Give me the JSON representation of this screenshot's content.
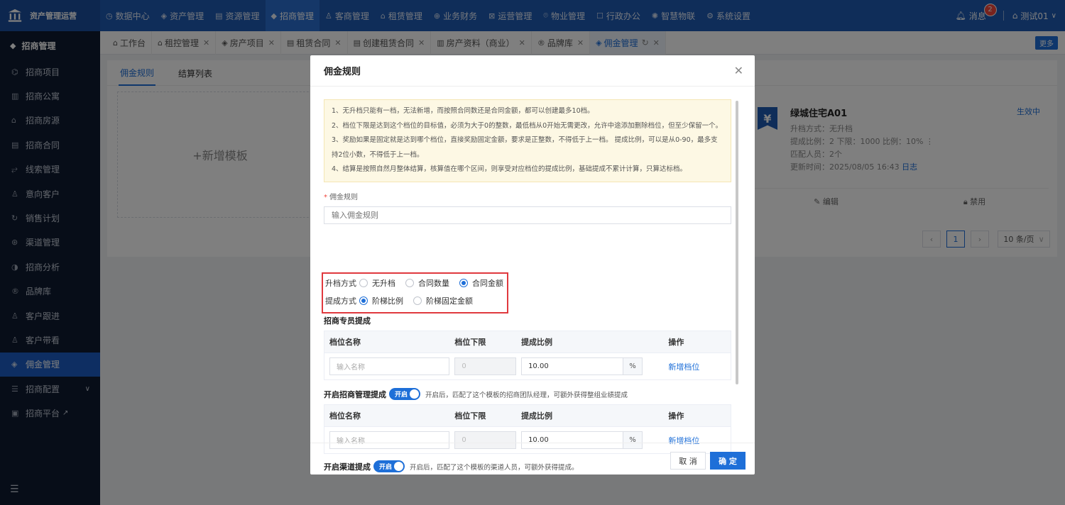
{
  "app": {
    "title": "资产管理运营"
  },
  "topnav": [
    {
      "label": "数据中心",
      "icon": "◷"
    },
    {
      "label": "资产管理",
      "icon": "◈"
    },
    {
      "label": "资源管理",
      "icon": "▤"
    },
    {
      "label": "招商管理",
      "icon": "◆",
      "active": true
    },
    {
      "label": "客商管理",
      "icon": "♙"
    },
    {
      "label": "租赁管理",
      "icon": "⌂"
    },
    {
      "label": "业务财务",
      "icon": "⊕"
    },
    {
      "label": "运营管理",
      "icon": "⊠"
    },
    {
      "label": "物业管理",
      "icon": "⌾"
    },
    {
      "label": "行政办公",
      "icon": "☐"
    },
    {
      "label": "智慧物联",
      "icon": "✺"
    },
    {
      "label": "系统设置",
      "icon": "⚙"
    }
  ],
  "header": {
    "message_label": "消息",
    "message_count": "2",
    "user_name": "测试01"
  },
  "sidebar": {
    "title": "招商管理",
    "items": [
      {
        "label": "招商项目",
        "icon": "⌬"
      },
      {
        "label": "招商公寓",
        "icon": "▥"
      },
      {
        "label": "招商房源",
        "icon": "⌂"
      },
      {
        "label": "招商合同",
        "icon": "▤"
      },
      {
        "label": "线索管理",
        "icon": "⥂"
      },
      {
        "label": "意向客户",
        "icon": "♙"
      },
      {
        "label": "销售计划",
        "icon": "↻"
      },
      {
        "label": "渠道管理",
        "icon": "⊛"
      },
      {
        "label": "招商分析",
        "icon": "◑"
      },
      {
        "label": "品牌库",
        "icon": "®"
      },
      {
        "label": "客户跟进",
        "icon": "♙"
      },
      {
        "label": "客户带看",
        "icon": "♙"
      },
      {
        "label": "佣金管理",
        "icon": "◈",
        "active": true
      },
      {
        "label": "招商配置",
        "icon": "☰"
      },
      {
        "label": "招商平台",
        "icon": "▣"
      }
    ],
    "collapse_icon": "☰"
  },
  "tabs": [
    {
      "label": "工作台",
      "icon": "⌂",
      "closable": false
    },
    {
      "label": "租控管理",
      "icon": "⌂",
      "closable": true
    },
    {
      "label": "房产项目",
      "icon": "◈",
      "closable": true
    },
    {
      "label": "租赁合同",
      "icon": "▤",
      "closable": true
    },
    {
      "label": "创建租赁合同",
      "icon": "▤",
      "closable": true
    },
    {
      "label": "房产资料（商业）",
      "icon": "▥",
      "closable": true
    },
    {
      "label": "品牌库",
      "icon": "®",
      "closable": true
    },
    {
      "label": "佣金管理",
      "icon": "◈",
      "closable": true,
      "active": true
    }
  ],
  "more_label": "更多",
  "main": {
    "subtabs": [
      {
        "label": "佣金规则",
        "active": true
      },
      {
        "label": "结算列表"
      }
    ],
    "add_template_label": "+新增模板",
    "card": {
      "title": "绿城住宅A01",
      "status": "生效中",
      "line1": "升档方式：无升档",
      "line2": "提成比例：2  下限：1000  比例：10% ⋮",
      "line3": "匹配人员：2个",
      "line4": "更新时间：2025/08/05 16:43",
      "log_link": "日志",
      "edit_label": "编辑",
      "disable_label": "禁用"
    },
    "pager": {
      "current": "1",
      "size": "10 条/页"
    }
  },
  "modal": {
    "title": "佣金规则",
    "notices": [
      "1、无升档只能有一档，无法新增，而按照合同数还是合同金额，都可以创建最多10档。",
      "2、档位下限是达到这个档位的目标值，必须为大于0的整数，最低档从0开始无需更改，允许中途添加删除档位，但至少保留一个。",
      "3、奖励如果是固定就是达到哪个档位，直接奖励固定金额，要求是正整数，不得低于上一档。 提成比例，可以是从0-90，最多支持2位小数，不得低于上一档。",
      "4、结算是按照自然月整体结算，核算值在哪个区间，则享受对应档位的提成比例，基础提成不累计计算，只算达标档。"
    ],
    "rule_label": "佣金规则",
    "rule_placeholder": "输入佣金规则",
    "upgrade_label": "升档方式",
    "upgrade_options": [
      {
        "label": "无升档",
        "checked": false
      },
      {
        "label": "合同数量",
        "checked": false
      },
      {
        "label": "合同金额",
        "checked": true
      }
    ],
    "commission_label": "提成方式",
    "commission_options": [
      {
        "label": "阶梯比例",
        "checked": true
      },
      {
        "label": "阶梯固定金额",
        "checked": false
      }
    ],
    "section1_title": "招商专员提成",
    "table_headers": [
      "档位名称",
      "档位下限",
      "提成比例",
      "操作"
    ],
    "name_placeholder": "输入名称",
    "lower_limit": "0",
    "ratio_value": "10.00",
    "pct_suffix": "%",
    "add_level_label": "新增档位",
    "section2_title": "开启招商管理提成",
    "section2_toggle": "开启",
    "section2_hint": "开启后，匹配了这个模板的招商团队经理，可额外获得整组业绩提成",
    "section3_title": "开启渠道提成",
    "section3_toggle": "开启",
    "section3_hint": "开启后，匹配了这个模板的渠道人员，可额外获得提成。",
    "cancel_label": "取 消",
    "ok_label": "确 定"
  }
}
